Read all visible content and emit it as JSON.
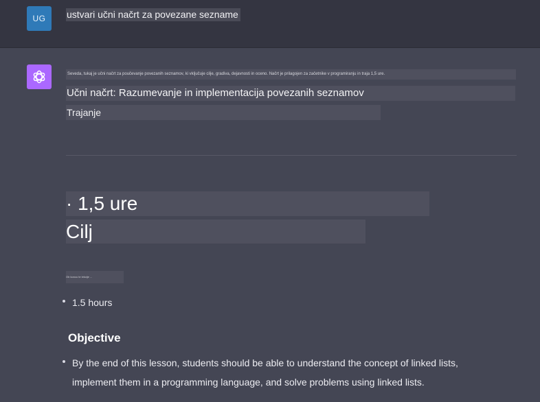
{
  "user": {
    "avatar_initials": "UG",
    "message": "ustvari učni načrt za povezane seznamе"
  },
  "assistant": {
    "avatar_icon": "openai-logo-icon",
    "tiny_line": "Seveda, tukaj je učni načrt za poučevanje povezanih seznamov, ki vključuje cilje, gradiva, dejavnosti in oceno. Načrt je prilagojen za začetnike v programiranju in traja 1,5 ure.",
    "plan_title": "Učni načrt: Razumevanje in implementacija povezanih seznamov",
    "duration_label": "Trajanje",
    "big_hours": "· 1,5 ure",
    "big_goal": "Cilj",
    "tiny_text": "Ob koncu te lekcije ...",
    "bullet_hours": "1.5 hours",
    "objective_heading": "Objective",
    "objective_text_line1": "By the end of this lesson, students should be able to understand the concept of linked lists,",
    "objective_text_line2": "implement them in a programming language, and solve problems using linked lists."
  },
  "colors": {
    "user_row_bg": "#343541",
    "assistant_row_bg": "#444654",
    "user_avatar": "#2f7ab8",
    "assistant_avatar": "#ab68ff"
  }
}
